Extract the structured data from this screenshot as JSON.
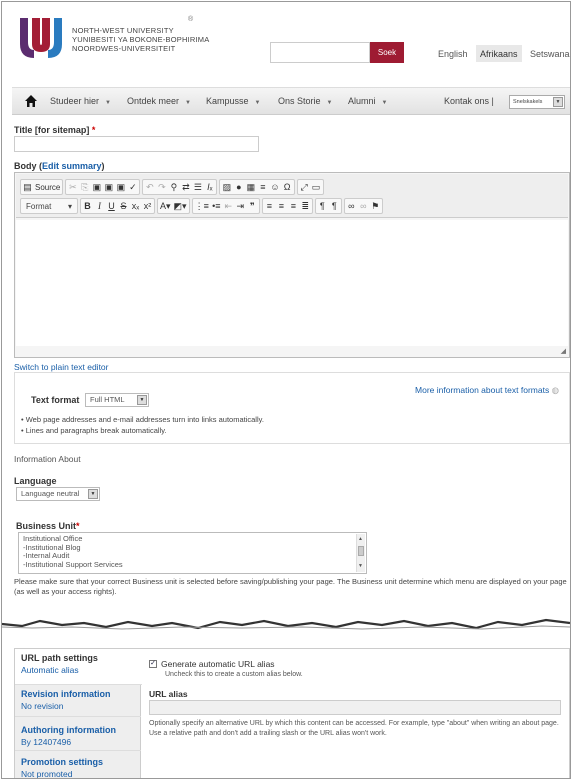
{
  "header": {
    "logo_line1": "NORTH-WEST UNIVERSITY",
    "logo_line2": "YUNIBESITI YA BOKONE-BOPHIRIMA",
    "logo_line3": "NOORDWES-UNIVERSITEIT",
    "logo_mark": "®",
    "search_placeholder": "",
    "search_button": "Soek",
    "languages": [
      "English",
      "Afrikaans",
      "Setswana"
    ],
    "active_language": "Afrikaans"
  },
  "nav": {
    "items": [
      "Studeer hier",
      "Ontdek meer",
      "Kampusse",
      "Ons Storie",
      "Alumni"
    ],
    "contact": "Kontak ons |",
    "select_value": "Snelskakels"
  },
  "form": {
    "title_label": "Title [for sitemap]",
    "title_value": "",
    "body_label": "Body",
    "edit_summary": "Edit summary",
    "source_label": "Source",
    "format_label": "Format",
    "switch_editor": "Switch to plain text editor",
    "text_format_label": "Text format",
    "text_format_value": "Full HTML",
    "more_info": "More information about text formats",
    "tips": [
      "Web page addresses and e-mail addresses turn into links automatically.",
      "Lines and paragraphs break automatically."
    ],
    "information_about": "Information About",
    "language_label": "Language",
    "language_value": "Language neutral",
    "business_unit_label": "Business Unit",
    "business_units": [
      "Institutional Office",
      "-Institutional Blog",
      "-Internal Audit",
      "-Institutional Support Services"
    ],
    "business_unit_note": "Please make sure that your correct Business unit is selected before saving/publishing your page. The Business unit determine which menu are displayed on your page (as well as your access rights)."
  },
  "vertical_tabs": [
    {
      "title": "URL path settings",
      "summary": "Automatic alias"
    },
    {
      "title": "Revision information",
      "summary": "No revision"
    },
    {
      "title": "Authoring information",
      "summary": "By 12407496"
    },
    {
      "title": "Promotion settings",
      "summary": "Not promoted"
    }
  ],
  "url_pane": {
    "checkbox_label": "Generate automatic URL alias",
    "checkbox_help": "Uncheck this to create a custom alias below.",
    "checked": true,
    "alias_label": "URL alias",
    "alias_value": "",
    "alias_help": "Optionally specify an alternative URL by which this content can be accessed. For example, type \"about\" when writing an about page. Use a relative path and don't add a trailing slash or the URL alias won't work."
  },
  "colors": {
    "brand": "#9e1b32",
    "link": "#1a5fa8",
    "logo_purple": "#5b2c6f",
    "logo_red": "#a31e36",
    "logo_blue": "#2a7bbf"
  }
}
